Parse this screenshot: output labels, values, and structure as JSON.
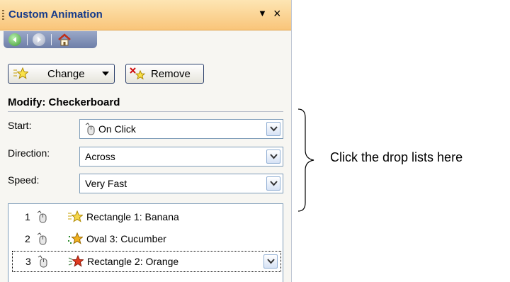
{
  "panel": {
    "title": "Custom Animation",
    "dropdown_arrow": "▼",
    "close_glyph": "×"
  },
  "nav": {
    "icons": [
      "back-icon",
      "forward-icon",
      "home-icon"
    ]
  },
  "buttons": {
    "change_label": "Change",
    "remove_label": "Remove"
  },
  "modify": {
    "heading": "Modify: Checkerboard",
    "fields": [
      {
        "label": "Start:",
        "value": "On Click",
        "icon": "mouse-icon"
      },
      {
        "label": "Direction:",
        "value": "Across"
      },
      {
        "label": "Speed:",
        "value": "Very Fast"
      }
    ]
  },
  "animation_list": [
    {
      "number": "1",
      "name": "Rectangle 1: Banana",
      "effect_color": "#f5d64a"
    },
    {
      "number": "2",
      "name": "Oval 3: Cucumber",
      "effect_color": "#f0b020"
    },
    {
      "number": "3",
      "name": "Rectangle 2: Orange",
      "effect_color": "#e03a20",
      "selected": true
    }
  ],
  "annotation": "Click the drop lists here",
  "colors": {
    "title_text": "#153a8a",
    "titlebar": "#f9c57a",
    "nav_bar": "#6d7ea8",
    "input_border": "#7f9db9"
  }
}
